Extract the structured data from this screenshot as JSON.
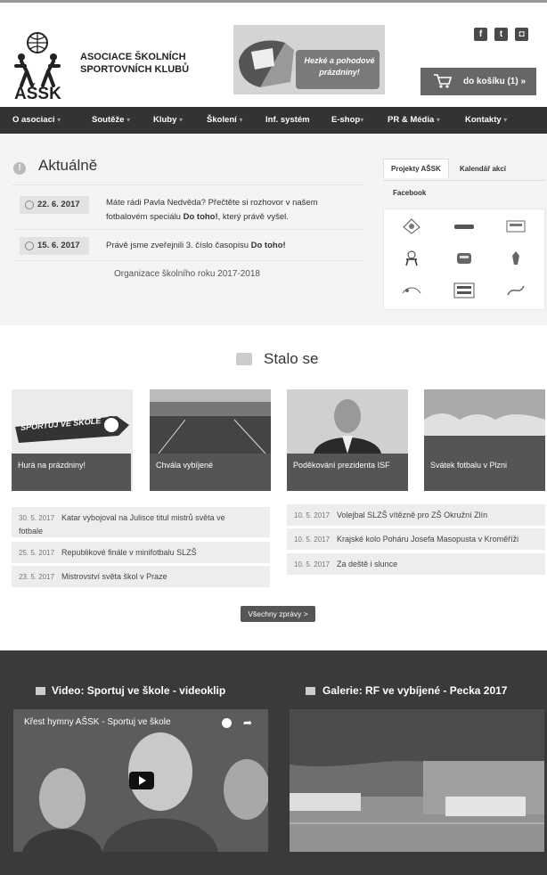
{
  "header": {
    "logo_text": "AŠSK",
    "org_name_line1": "ASOCIACE ŠKOLNÍCH",
    "org_name_line2": "SPORTOVNÍCH KLUBŮ",
    "promo_line1": "Hezké a pohodové",
    "promo_line2": "prázdniny!",
    "social": [
      {
        "icon": "facebook-icon",
        "glyph": "f"
      },
      {
        "icon": "twitter-icon",
        "glyph": "t"
      },
      {
        "icon": "instagram-icon",
        "glyph": "◘"
      }
    ],
    "cart_label": "do košíku (1) »"
  },
  "nav": {
    "items": [
      {
        "label": "O asociaci",
        "caret": "▾"
      },
      {
        "label": "Soutěže",
        "caret": "▾"
      },
      {
        "label": "Kluby",
        "caret": "▾"
      },
      {
        "label": "Školení",
        "caret": "▾"
      },
      {
        "label": "Inf. systém",
        "caret": ""
      },
      {
        "label": "E-shop",
        "caret": "▾"
      },
      {
        "label": "PR & Média",
        "caret": "▾"
      },
      {
        "label": "Kontakty",
        "caret": "▾"
      }
    ]
  },
  "news": {
    "title": "Aktuálně",
    "items": [
      {
        "date": "22. 6. 2017",
        "line1": "Máte rádi Pavla Nedvěda? Přečtěte si rozhovor v našem",
        "line2_pre": "fotbalovém speciálu ",
        "line2_bold": "Do toho!",
        "line2_post": ", který právě vyšel."
      },
      {
        "date": "15. 6. 2017",
        "line1_pre": "Právě jsme zveřejnili 3. číslo časopisu ",
        "line1_bold": "Do toho!"
      }
    ],
    "link": "Organizace školního roku 2017-2018"
  },
  "tabs": {
    "items": [
      "Projekty AŠSK",
      "Kalendář akcí",
      "Facebook"
    ]
  },
  "stalo": {
    "title": "Stalo se",
    "cards": [
      {
        "caption": "Hurá na prázdniny!",
        "badge": "SPORTUJ VE ŠKOLE"
      },
      {
        "caption": "Chvála vybíjené"
      },
      {
        "caption": "Poděkování prezidenta ISF"
      },
      {
        "caption": "Svátek fotbalu v Plzni"
      }
    ],
    "left_list": [
      {
        "date": "30. 5. 2017",
        "text": "Katar vybojoval na Julisce titul mistrů světa ve",
        "text2": "fotbale"
      },
      {
        "date": "25. 5. 2017",
        "text": "Republikové finále v minifotbalu SLZŠ"
      },
      {
        "date": "23. 5. 2017",
        "text": "Mistrovství světa škol v Praze"
      }
    ],
    "right_list": [
      {
        "date": "10. 5. 2017",
        "text": "Volejbal SLZŠ vítězně pro ZŠ Okružní Zlín"
      },
      {
        "date": "10. 5. 2017",
        "text": "Krajské kolo Poháru Josefa Masopusta v Kroměříži"
      },
      {
        "date": "10. 5. 2017",
        "text": "Za deště i slunce"
      }
    ],
    "more_button": "Všechny zprávy >"
  },
  "media": {
    "video_prefix": "Video:",
    "video_title": "Sportuj ve škole - videoklip",
    "video_embed_title": "Křest hymny AŠSK - Sportuj ve škole",
    "gallery_prefix": "Galerie:",
    "gallery_title": "RF ve vybíjené - Pecka 2017"
  }
}
